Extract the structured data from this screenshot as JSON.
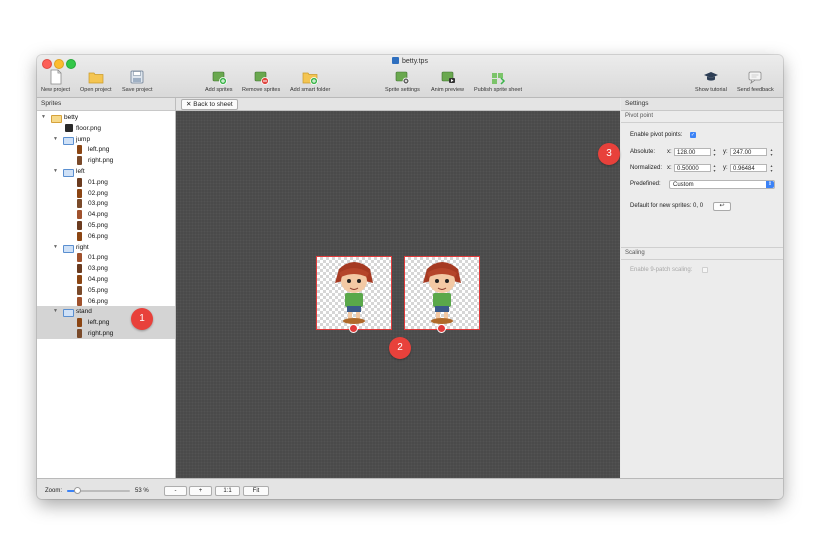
{
  "window": {
    "title": "betty.tps"
  },
  "toolbar": {
    "new_project": "New project",
    "open_project": "Open project",
    "save_project": "Save project",
    "add_sprites": "Add sprites",
    "remove_sprites": "Remove sprites",
    "add_smart_folder": "Add smart folder",
    "sprite_settings": "Sprite settings",
    "anim_preview": "Anim preview",
    "publish_sprite_sheet": "Publish sprite sheet",
    "show_tutorial": "Show tutorial",
    "send_feedback": "Send feedback"
  },
  "sprites_panel": {
    "header": "Sprites",
    "tree": [
      {
        "label": "betty",
        "type": "folder-root",
        "depth": 0
      },
      {
        "label": "floor.png",
        "type": "file",
        "depth": 1
      },
      {
        "label": "jump",
        "type": "folder",
        "depth": 1
      },
      {
        "label": "left.png",
        "type": "file",
        "depth": 2
      },
      {
        "label": "right.png",
        "type": "file",
        "depth": 2
      },
      {
        "label": "left",
        "type": "folder",
        "depth": 1
      },
      {
        "label": "01.png",
        "type": "file",
        "depth": 2
      },
      {
        "label": "02.png",
        "type": "file",
        "depth": 2
      },
      {
        "label": "03.png",
        "type": "file",
        "depth": 2
      },
      {
        "label": "04.png",
        "type": "file",
        "depth": 2
      },
      {
        "label": "05.png",
        "type": "file",
        "depth": 2
      },
      {
        "label": "06.png",
        "type": "file",
        "depth": 2
      },
      {
        "label": "right",
        "type": "folder",
        "depth": 1
      },
      {
        "label": "01.png",
        "type": "file",
        "depth": 2
      },
      {
        "label": "03.png",
        "type": "file",
        "depth": 2
      },
      {
        "label": "04.png",
        "type": "file",
        "depth": 2
      },
      {
        "label": "05.png",
        "type": "file",
        "depth": 2
      },
      {
        "label": "06.png",
        "type": "file",
        "depth": 2
      },
      {
        "label": "stand",
        "type": "folder",
        "depth": 1
      },
      {
        "label": "left.png",
        "type": "file",
        "depth": 2
      },
      {
        "label": "right.png",
        "type": "file",
        "depth": 2
      }
    ]
  },
  "canvas": {
    "back_to_sheet": "Back to sheet"
  },
  "settings": {
    "header": "Settings",
    "pivot_section": "Pivot point",
    "enable_pivot_label": "Enable pivot points:",
    "enable_pivot_checked": true,
    "absolute_label": "Absolute:",
    "absolute_x_label": "x:",
    "absolute_x": "128.00",
    "absolute_y_label": "y:",
    "absolute_y": "247.00",
    "normalized_label": "Normalized:",
    "normalized_x_label": "x:",
    "normalized_x": "0.50000",
    "normalized_y_label": "y:",
    "normalized_y": "0.96484",
    "predefined_label": "Predefined:",
    "predefined_value": "Custom",
    "default_label": "Default for new sprites: 0, 0",
    "default_button": "↩",
    "scaling_section": "Scaling",
    "nine_patch_label": "Enable 9-patch scaling:",
    "nine_patch_checked": false
  },
  "bottombar": {
    "zoom_label": "Zoom:",
    "zoom_value": "53 %",
    "zoom_level": 0.53,
    "minus": "-",
    "plus": "+",
    "one_to_one": "1:1",
    "fit": "Fit"
  },
  "callouts": {
    "one": "1",
    "two": "2",
    "three": "3"
  },
  "colors": {
    "accent": "#3b82f6",
    "callout": "#e8413b",
    "pivot_box": "#e03a3a"
  }
}
